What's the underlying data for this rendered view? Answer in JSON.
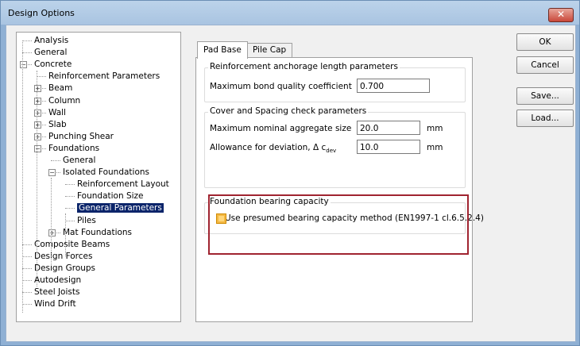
{
  "window": {
    "title": "Design Options",
    "close_glyph": "✕"
  },
  "tree": {
    "items": [
      {
        "label": "Analysis",
        "expander": ""
      },
      {
        "label": "General",
        "expander": ""
      },
      {
        "label": "Concrete",
        "expander": "-"
      },
      {
        "label": "Reinforcement Parameters",
        "expander": ""
      },
      {
        "label": "Beam",
        "expander": "+"
      },
      {
        "label": "Column",
        "expander": "+"
      },
      {
        "label": "Wall",
        "expander": "+"
      },
      {
        "label": "Slab",
        "expander": "+"
      },
      {
        "label": "Punching Shear",
        "expander": "+"
      },
      {
        "label": "Foundations",
        "expander": "-"
      },
      {
        "label": "General",
        "expander": ""
      },
      {
        "label": "Isolated Foundations",
        "expander": "-"
      },
      {
        "label": "Reinforcement Layout",
        "expander": ""
      },
      {
        "label": "Foundation Size",
        "expander": ""
      },
      {
        "label": "General Parameters",
        "expander": "",
        "selected": true
      },
      {
        "label": "Piles",
        "expander": ""
      },
      {
        "label": "Mat Foundations",
        "expander": "+"
      },
      {
        "label": "Composite Beams",
        "expander": ""
      },
      {
        "label": "Design Forces",
        "expander": ""
      },
      {
        "label": "Design Groups",
        "expander": ""
      },
      {
        "label": "Autodesign",
        "expander": ""
      },
      {
        "label": "Steel Joists",
        "expander": ""
      },
      {
        "label": "Wind Drift",
        "expander": ""
      }
    ]
  },
  "tabs": [
    {
      "label": "Pad Base",
      "active": true
    },
    {
      "label": "Pile Cap",
      "active": false
    }
  ],
  "anchorage": {
    "title": "Reinforcement anchorage length parameters",
    "bond_label": "Maximum bond quality coefficient",
    "bond_value": "0.700"
  },
  "cover": {
    "title": "Cover and Spacing check parameters",
    "agg_label": "Maximum nominal aggregate size",
    "agg_value": "20.0",
    "agg_unit": "mm",
    "dev_label": "Allowance for deviation, Δ c",
    "dev_sub": "dev",
    "dev_value": "10.0",
    "dev_unit": "mm"
  },
  "bearing": {
    "title": "Foundation bearing capacity",
    "checkbox_label": "Use presumed bearing capacity method (EN1997-1 cl.6.5.2.4)",
    "checked": false,
    "highlight_color": "#a02430"
  },
  "buttons": {
    "ok": "OK",
    "cancel": "Cancel",
    "save": "Save...",
    "load": "Load..."
  }
}
